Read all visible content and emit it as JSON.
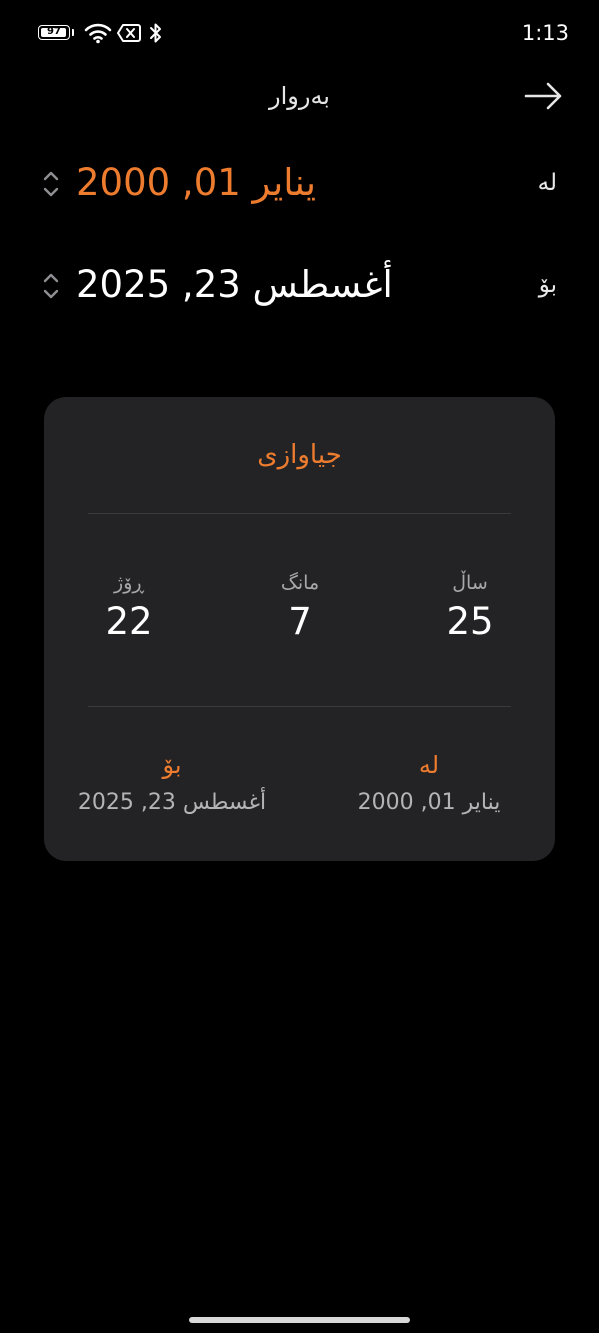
{
  "status_bar": {
    "battery_level": "97",
    "battery_fraction": 0.97,
    "time": "1:13",
    "icons": [
      "wifi-icon",
      "no-sim-icon",
      "bluetooth-icon"
    ]
  },
  "header": {
    "title": "بەروار",
    "action_icon": "arrow-right-icon"
  },
  "from_row": {
    "label": "لە",
    "value": "ينایر 01, 2000"
  },
  "to_row": {
    "label": "بۆ",
    "value": "أغسطس 23, 2025"
  },
  "card": {
    "title": "جیاوازی",
    "years": {
      "label": "ساڵ",
      "value": "25"
    },
    "months": {
      "label": "مانگ",
      "value": "7"
    },
    "days": {
      "label": "ڕۆژ",
      "value": "22"
    },
    "from": {
      "label": "لە",
      "value": "ينایر 01, 2000"
    },
    "to": {
      "label": "بۆ",
      "value": "أغسطس 23, 2025"
    }
  },
  "colors": {
    "accent": "#ee7c2f",
    "background": "#000000",
    "card": "#232325"
  }
}
